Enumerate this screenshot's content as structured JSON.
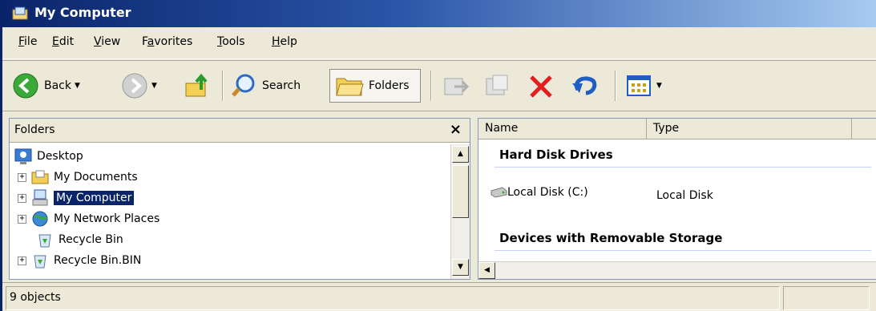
{
  "window": {
    "title": "My Computer"
  },
  "menu": [
    {
      "label": "File",
      "mnemonic": "F",
      "rest": "ile"
    },
    {
      "label": "Edit",
      "mnemonic": "E",
      "rest": "dit"
    },
    {
      "label": "View",
      "mnemonic": "V",
      "rest": "iew"
    },
    {
      "label": "Favorites",
      "mnemonic": "a",
      "pre": "F",
      "rest": "vorites"
    },
    {
      "label": "Tools",
      "mnemonic": "T",
      "rest": "ools"
    },
    {
      "label": "Help",
      "mnemonic": "H",
      "rest": "elp"
    }
  ],
  "toolbar": {
    "back_label": "Back",
    "search_label": "Search",
    "folders_label": "Folders"
  },
  "folders_pane": {
    "header": "Folders",
    "close_glyph": "×",
    "tree": [
      {
        "label": "Desktop",
        "icon": "desktop-icon",
        "expander": ""
      },
      {
        "label": "My Documents",
        "icon": "my-documents-icon",
        "expander": "+"
      },
      {
        "label": "My Computer",
        "icon": "my-computer-icon",
        "expander": "+",
        "selected": true
      },
      {
        "label": "My Network Places",
        "icon": "network-places-icon",
        "expander": "+"
      },
      {
        "label": "Recycle Bin",
        "icon": "recycle-bin-icon",
        "expander": ""
      },
      {
        "label": "Recycle Bin.BIN",
        "icon": "recycle-bin-icon",
        "expander": "+"
      }
    ]
  },
  "content_pane": {
    "columns": [
      "Name",
      "Type"
    ],
    "groups": [
      {
        "title": "Hard Disk Drives"
      },
      {
        "title": "Devices with Removable Storage"
      }
    ],
    "items": [
      {
        "name": "Local Disk (C:)",
        "type": "Local Disk",
        "icon": "hard-disk-icon"
      }
    ]
  },
  "status": {
    "objects": "9 objects"
  },
  "colors": {
    "title_start": "#0a246a",
    "title_end": "#a6caf0",
    "selection": "#0a246a"
  }
}
